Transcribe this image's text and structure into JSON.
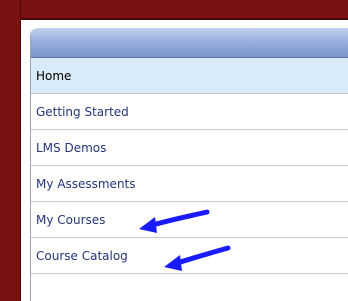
{
  "nav": {
    "items": [
      {
        "label": "Home"
      },
      {
        "label": "Getting Started"
      },
      {
        "label": "LMS Demos"
      },
      {
        "label": "My Assessments"
      },
      {
        "label": "My Courses"
      },
      {
        "label": "Course Catalog"
      }
    ]
  },
  "annotations": {
    "arrow_color": "#1a1aff",
    "arrow_targets": [
      "My Courses",
      "Course Catalog"
    ]
  },
  "colors": {
    "frame": "#7a1212",
    "active_item_bg": "#d9eaf9",
    "link_text": "#24357a"
  }
}
